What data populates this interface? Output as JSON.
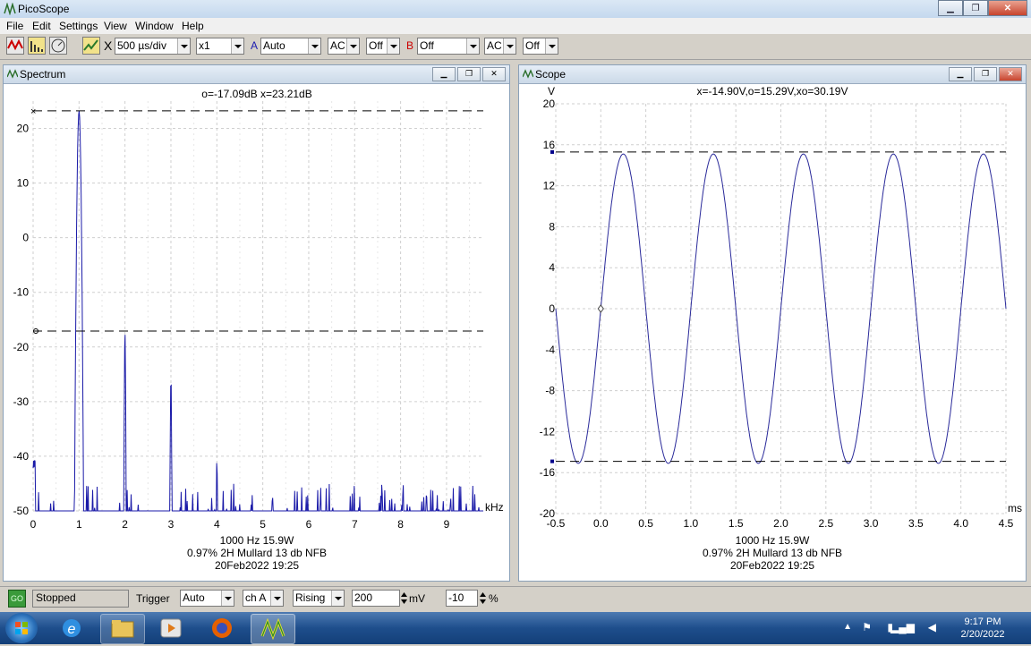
{
  "app": {
    "title": "PicoScope"
  },
  "menu": [
    "File",
    "Edit",
    "Settings",
    "View",
    "Window",
    "Help"
  ],
  "toolbar": {
    "close_glyph": "X",
    "timebase": "500 µs/div",
    "multiplier": "x1",
    "channel_a_label": "A",
    "channel_a_range": "Auto",
    "channel_a_coupling": "AC",
    "channel_a_offset": "Off",
    "channel_b_label": "B",
    "channel_b_range": "Off",
    "channel_b_coupling": "AC",
    "channel_b_offset": "Off"
  },
  "spectrum": {
    "window_title": "Spectrum",
    "readout": "o=-17.09dB  x=23.21dB",
    "x_unit": "kHz",
    "caption": [
      "1000 Hz 15.9W",
      "0.97% 2H Mullard 13 db NFB",
      "20Feb2022  19:25"
    ],
    "chart_data": {
      "type": "line",
      "xlim": [
        0,
        9.8
      ],
      "ylim": [
        -50,
        25
      ],
      "x_ticks": [
        "0",
        "1",
        "2",
        "3",
        "4",
        "5",
        "6",
        "7",
        "8",
        "9"
      ],
      "y_ticks": [
        "20",
        "10",
        "0",
        "-10",
        "-20",
        "-30",
        "-40",
        "-50"
      ],
      "markers": {
        "x": 23.21,
        "o": -17.09
      },
      "peaks": [
        {
          "f": 1.0,
          "db": 23.2
        },
        {
          "f": 2.0,
          "db": -17.1
        },
        {
          "f": 3.0,
          "db": -25.5
        },
        {
          "f": 4.0,
          "db": -40.5
        }
      ],
      "series_color": "#1a1aa8"
    }
  },
  "scope": {
    "window_title": "Scope",
    "y_unit": "V",
    "readout": "x=-14.90V,o=15.29V,xo=30.19V",
    "x_unit": "ms",
    "caption": [
      "1000 Hz 15.9W",
      "0.97% 2H Mullard 13 db NFB",
      "20Feb2022  19:25"
    ],
    "chart_data": {
      "type": "line",
      "xlim": [
        -0.5,
        4.5
      ],
      "ylim": [
        -20,
        20
      ],
      "x_ticks": [
        "-0.5",
        "0.0",
        "0.5",
        "1.0",
        "1.5",
        "2.0",
        "2.5",
        "3.0",
        "3.5",
        "4.0",
        "4.5"
      ],
      "y_ticks": [
        "20",
        "16",
        "12",
        "8",
        "4",
        "0",
        "-4",
        "-8",
        "-12",
        "-16",
        "-20"
      ],
      "frequency_khz": 1.0,
      "amplitude_v": 15.1,
      "markers": {
        "x": -14.9,
        "o": 15.29
      },
      "series_color": "#2a2a9a"
    }
  },
  "status": {
    "go_label": "GO",
    "state": "Stopped",
    "trigger_label": "Trigger",
    "trigger_mode": "Auto",
    "trigger_channel": "ch A",
    "trigger_edge": "Rising",
    "threshold": "200",
    "threshold_unit": "mV",
    "pretrigger": "-10",
    "pretrigger_unit": "%"
  },
  "taskbar": {
    "time": "9:17 PM",
    "date": "2/20/2022"
  }
}
